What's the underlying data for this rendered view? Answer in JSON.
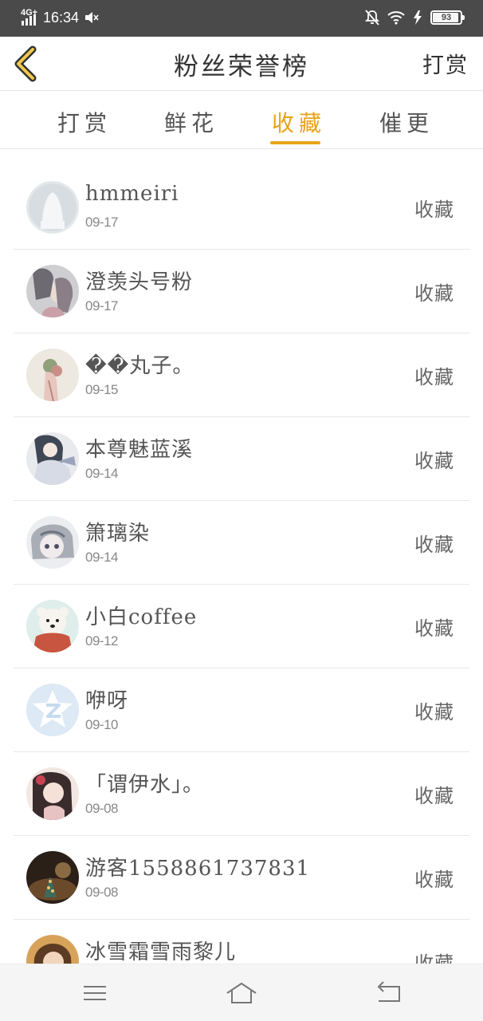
{
  "status_bar": {
    "network": "4G+",
    "time": "16:34",
    "battery": "93",
    "battery_level": 0.93
  },
  "header": {
    "title": "粉丝荣誉榜",
    "action_label": "打赏",
    "back_icon": "chevron-left-icon"
  },
  "tabs": [
    {
      "label": "打赏",
      "active": false
    },
    {
      "label": "鲜花",
      "active": false
    },
    {
      "label": "收藏",
      "active": true
    },
    {
      "label": "催更",
      "active": false
    }
  ],
  "accent_color": "#e8a317",
  "fans": [
    {
      "name": "hmmeiri",
      "date": "09-17",
      "action": "收藏",
      "avatar": "default-avatar-icon"
    },
    {
      "name": "澄羡头号粉",
      "date": "09-17",
      "action": "收藏",
      "avatar": "avatar-image"
    },
    {
      "name": "��丸子。",
      "date": "09-15",
      "action": "收藏",
      "avatar": "avatar-image"
    },
    {
      "name": "本尊魅蓝溪",
      "date": "09-14",
      "action": "收藏",
      "avatar": "avatar-image"
    },
    {
      "name": "箫璃染",
      "date": "09-14",
      "action": "收藏",
      "avatar": "avatar-image"
    },
    {
      "name": "小白coffee",
      "date": "09-12",
      "action": "收藏",
      "avatar": "avatar-image"
    },
    {
      "name": "咿呀",
      "date": "09-10",
      "action": "收藏",
      "avatar": "qq-logo-icon"
    },
    {
      "name": "「谓伊水」。",
      "date": "09-08",
      "action": "收藏",
      "avatar": "avatar-image"
    },
    {
      "name": "游客1558861737831",
      "date": "09-08",
      "action": "收藏",
      "avatar": "avatar-image"
    },
    {
      "name": "冰雪霜雪雨黎儿",
      "date": "",
      "action": "收藏",
      "avatar": "avatar-image"
    }
  ],
  "nav": {
    "menu_icon": "menu-icon",
    "home_icon": "home-icon",
    "back_icon": "back-icon"
  }
}
